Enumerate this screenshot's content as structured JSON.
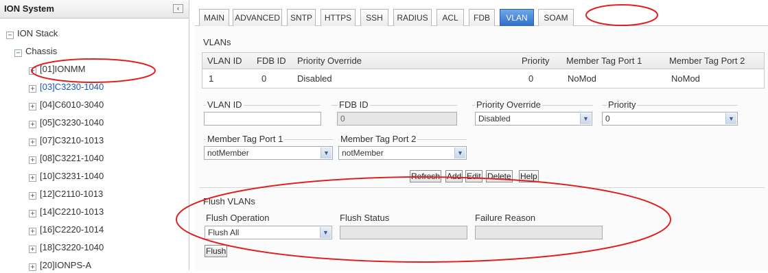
{
  "left_panel": {
    "title": "ION System",
    "collapse_glyph": "‹",
    "tree": [
      {
        "toggle": "−",
        "label": "ION Stack",
        "selected": false
      },
      {
        "toggle": "−",
        "label": "Chassis",
        "selected": false
      },
      {
        "toggle": "+",
        "label": "[01]IONMM",
        "selected": false
      },
      {
        "toggle": "+",
        "label": "[03]C3230-1040",
        "selected": true
      },
      {
        "toggle": "+",
        "label": "[04]C6010-3040",
        "selected": false
      },
      {
        "toggle": "+",
        "label": "[05]C3230-1040",
        "selected": false
      },
      {
        "toggle": "+",
        "label": "[07]C3210-1013",
        "selected": false
      },
      {
        "toggle": "+",
        "label": "[08]C3221-1040",
        "selected": false
      },
      {
        "toggle": "+",
        "label": "[10]C3231-1040",
        "selected": false
      },
      {
        "toggle": "+",
        "label": "[12]C2110-1013",
        "selected": false
      },
      {
        "toggle": "+",
        "label": "[14]C2210-1013",
        "selected": false
      },
      {
        "toggle": "+",
        "label": "[16]C2220-1014",
        "selected": false
      },
      {
        "toggle": "+",
        "label": "[18]C3220-1040",
        "selected": false
      },
      {
        "toggle": "+",
        "label": "[20]IONPS-A",
        "selected": false
      }
    ]
  },
  "tabs": [
    {
      "label": "MAIN",
      "active": false
    },
    {
      "label": "ADVANCED",
      "active": false
    },
    {
      "label": "SNTP",
      "active": false
    },
    {
      "label": "HTTPS",
      "active": false
    },
    {
      "label": "SSH",
      "active": false
    },
    {
      "label": "RADIUS",
      "active": false
    },
    {
      "label": "ACL",
      "active": false
    },
    {
      "label": "FDB",
      "active": false
    },
    {
      "label": "VLAN",
      "active": true
    },
    {
      "label": "SOAM",
      "active": false
    }
  ],
  "vlans": {
    "title": "VLANs",
    "columns": [
      "VLAN ID",
      "FDB ID",
      "Priority Override",
      "Priority",
      "Member Tag Port 1",
      "Member Tag Port 2"
    ],
    "rows": [
      [
        "1",
        "0",
        "Disabled",
        "0",
        "NoMod",
        "NoMod"
      ]
    ]
  },
  "form": {
    "vlan_id": {
      "label": "VLAN ID",
      "value": ""
    },
    "fdb_id": {
      "label": "FDB ID",
      "value": "0"
    },
    "priority_override": {
      "label": "Priority Override",
      "value": "Disabled"
    },
    "priority": {
      "label": "Priority",
      "value": "0"
    },
    "member_tag_port1": {
      "label": "Member Tag Port 1",
      "value": "notMember"
    },
    "member_tag_port2": {
      "label": "Member Tag Port 2",
      "value": "notMember"
    }
  },
  "buttons": {
    "refresh": "Refresh",
    "add": "Add",
    "edit": "Edit",
    "delete": "Delete",
    "help": "Help"
  },
  "flush": {
    "title": "Flush VLANs",
    "operation": {
      "label": "Flush Operation",
      "value": "Flush All"
    },
    "status": {
      "label": "Flush Status",
      "value": ""
    },
    "failure": {
      "label": "Failure Reason",
      "value": ""
    },
    "button": "Flush"
  },
  "colors": {
    "annotation": "#e02020",
    "active_tab": "#2f6cc6",
    "selected_node": "#1a56b8"
  }
}
